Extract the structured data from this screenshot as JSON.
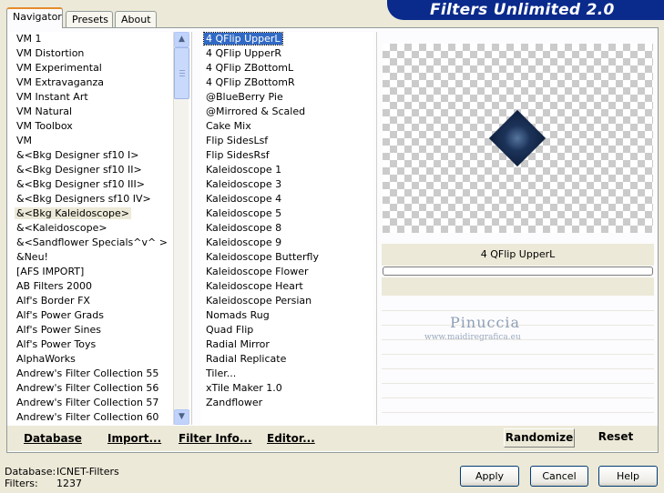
{
  "banner": {
    "title": "Filters Unlimited 2.0"
  },
  "tabs": [
    {
      "label": "Navigator",
      "active": true
    },
    {
      "label": "Presets",
      "active": false
    },
    {
      "label": "About",
      "active": false
    }
  ],
  "categories": [
    "VM 1",
    "VM Distortion",
    "VM Experimental",
    "VM Extravaganza",
    "VM Instant Art",
    "VM Natural",
    "VM Toolbox",
    "VM",
    "&<Bkg Designer sf10 I>",
    "&<Bkg Designer sf10 II>",
    "&<Bkg Designer sf10 III>",
    "&<Bkg Designers sf10 IV>",
    "&<Bkg Kaleidoscope>",
    "&<Kaleidoscope>",
    "&<Sandflower Specials^v^ >",
    "&Neu!",
    "[AFS IMPORT]",
    "AB Filters 2000",
    "Alf's Border FX",
    "Alf's Power Grads",
    "Alf's Power Sines",
    "Alf's Power Toys",
    "AlphaWorks",
    "Andrew's Filter Collection 55",
    "Andrew's Filter Collection 56",
    "Andrew's Filter Collection 57",
    "Andrew's Filter Collection 60"
  ],
  "selected_category": "&<Bkg Kaleidoscope>",
  "filters": [
    "4 QFlip UpperL",
    "4 QFlip UpperR",
    "4 QFlip ZBottomL",
    "4 QFlip ZBottomR",
    "@BlueBerry Pie",
    "@Mirrored & Scaled",
    "Cake Mix",
    "Flip SidesLsf",
    "Flip SidesRsf",
    "Kaleidoscope 1",
    "Kaleidoscope 3",
    "Kaleidoscope 4",
    "Kaleidoscope 5",
    "Kaleidoscope 8",
    "Kaleidoscope 9",
    "Kaleidoscope Butterfly",
    "Kaleidoscope Flower",
    "Kaleidoscope Heart",
    "Kaleidoscope Persian",
    "Nomads Rug",
    "Quad Flip",
    "Radial Mirror",
    "Radial Replicate",
    "Tiler...",
    "xTile Maker 1.0",
    "Zandflower"
  ],
  "selected_filter": "4 QFlip UpperL",
  "preview": {
    "filter_name": "4 QFlip UpperL",
    "progress": 0
  },
  "watermark": {
    "name": "Pinuccia",
    "url": "www.maidiregrafica.eu"
  },
  "toolbar": {
    "database": "Database",
    "import": "Import...",
    "filter_info": "Filter Info...",
    "editor": "Editor...",
    "randomize": "Randomize",
    "reset": "Reset"
  },
  "footer": {
    "database_label": "Database:",
    "database_value": "ICNET-Filters",
    "filters_label": "Filters:",
    "filters_value": "1237",
    "apply": "Apply",
    "cancel": "Cancel",
    "help": "Help"
  },
  "colors": {
    "banner": "#0a2a8c",
    "selection": "#316ac5",
    "dialog_bg": "#ece9d8",
    "active_tab_accent": "#e68b2c"
  }
}
